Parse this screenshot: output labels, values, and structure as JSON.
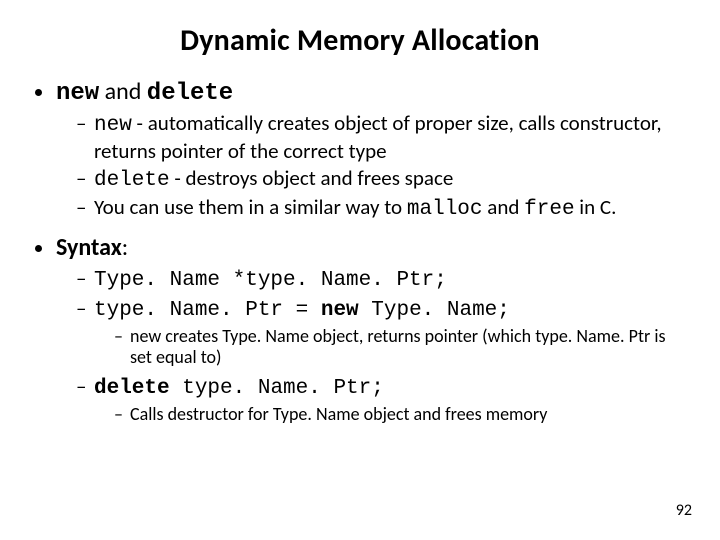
{
  "title": "Dynamic Memory Allocation",
  "sec1": {
    "kw_new": "new",
    "and": " and ",
    "kw_delete": "delete",
    "i1": {
      "kw": "new",
      "rest": " - automatically creates object of proper size, calls constructor, returns pointer of the correct type"
    },
    "i2": {
      "kw": "delete",
      "rest": " - destroys object and frees space"
    },
    "i3": {
      "pre": "You can use them in a similar way to ",
      "kw1": "malloc",
      "mid": " and ",
      "kw2": "free",
      "post": " in C."
    }
  },
  "sec2": {
    "label": "Syntax",
    "colon": ":",
    "line1": "Type. Name *type. Name. Ptr;",
    "line2a": "type. Name. Ptr = ",
    "line2b": "new",
    "line2c": " Type. Name;",
    "note1": "new creates Type. Name object, returns pointer (which type. Name. Ptr is set equal to)",
    "line3a": "delete",
    "line3b": " type. Name. Ptr;",
    "note2": "Calls destructor for Type. Name object and frees memory"
  },
  "page": "92"
}
